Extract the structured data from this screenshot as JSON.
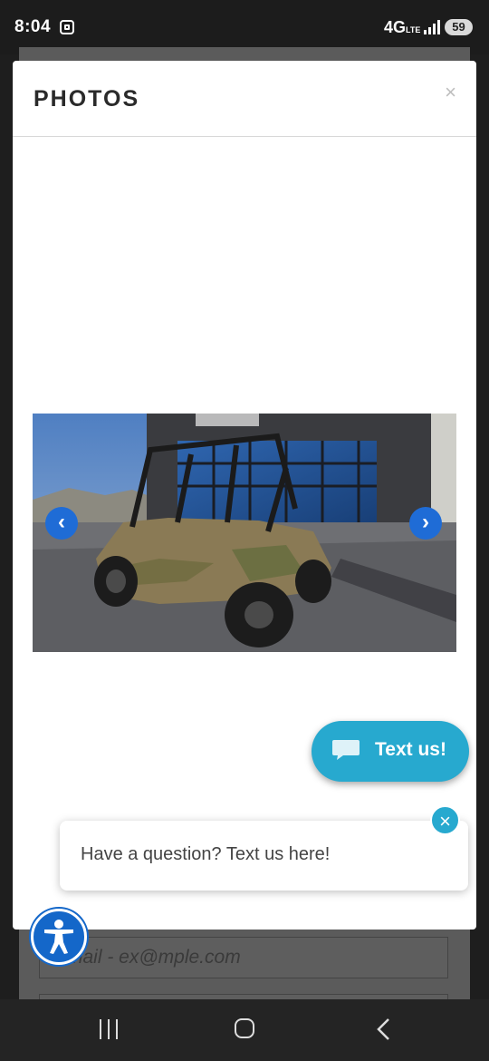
{
  "status_bar": {
    "time": "8:04",
    "network": "4G",
    "network_sub": "LTE",
    "battery": "59"
  },
  "background_form": {
    "email_placeholder": "Email - ex@mple.com"
  },
  "modal": {
    "title": "PHOTOS",
    "close_label": "×",
    "prev_label": "‹",
    "next_label": "›"
  },
  "chat_widget": {
    "button_label": "Text us!",
    "bubble_text": "Have a question? Text us here!",
    "bubble_close": "×"
  },
  "colors": {
    "accent": "#27a9cf",
    "arrow_blue": "#1f6cd6",
    "a11y_blue": "#1467c9"
  },
  "icons": {
    "screen_record": "screen-record-icon",
    "chat": "chat-bubble-icon",
    "accessibility": "accessibility-person-icon"
  }
}
